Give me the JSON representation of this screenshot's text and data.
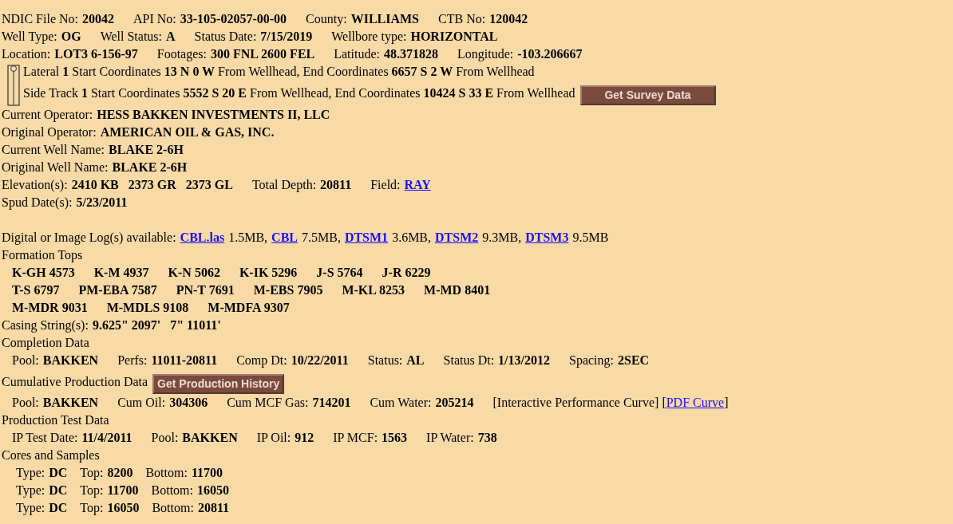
{
  "well_header": [
    [
      {
        "label": "NDIC File No:",
        "value": "20042"
      },
      {
        "label": "API No:",
        "value": "33-105-02057-00-00"
      },
      {
        "label": "County:",
        "value": "WILLIAMS"
      },
      {
        "label": "CTB No:",
        "value": "120042"
      }
    ],
    [
      {
        "label": "Well Type:",
        "value": "OG"
      },
      {
        "label": "Well Status:",
        "value": "A"
      },
      {
        "label": "Status Date:",
        "value": "7/15/2019"
      },
      {
        "label": "Wellbore type:",
        "value": "HORIZONTAL"
      }
    ],
    [
      {
        "label": "Location:",
        "value": "LOT3 6-156-97"
      },
      {
        "label": "Footages:",
        "value": "300 FNL 2600 FEL"
      },
      {
        "label": "Latitude:",
        "value": "48.371828"
      },
      {
        "label": "Longitude:",
        "value": "-103.206667"
      }
    ]
  ],
  "laterals": {
    "lines": [
      "Lateral **1** Start Coordinates **13 N 0 W** From Wellhead, End Coordinates **6657 S 2 W** From Wellhead",
      "Side Track **1** Start Coordinates **5552 S 20 E** From Wellhead, End Coordinates **10424 S 33 E** From Wellhead"
    ],
    "button": "Get Survey Data"
  },
  "operator_fields": [
    {
      "label": "Current Operator:",
      "value": "HESS BAKKEN INVESTMENTS II, LLC"
    },
    {
      "label": "Original Operator:",
      "value": "AMERICAN OIL & GAS, INC."
    },
    {
      "label": "Current Well Name:",
      "value": "BLAKE 2-6H"
    },
    {
      "label": "Original Well Name:",
      "value": "BLAKE 2-6H"
    }
  ],
  "elevation_row": {
    "fields": [
      {
        "label": "Elevation(s):",
        "value": "2410 KB   2373 GR   2373 GL"
      },
      {
        "label": "Total Depth:",
        "value": "20811"
      }
    ],
    "field_label": "Field:",
    "field_link": "RAY"
  },
  "spud": {
    "label": "Spud Date(s):",
    "value": "5/23/2011"
  },
  "logs": {
    "label": "Digital or Image Log(s) available:",
    "files": [
      {
        "name": "CBL.las",
        "size": "1.5MB,"
      },
      {
        "name": "CBL",
        "size": "7.5MB,"
      },
      {
        "name": "DTSM1",
        "size": "3.6MB,"
      },
      {
        "name": "DTSM2",
        "size": "9.3MB,"
      },
      {
        "name": "DTSM3",
        "size": "9.5MB"
      }
    ]
  },
  "formation_tops": {
    "title": "Formation Tops",
    "rows": [
      [
        "K-GH 4573",
        "K-M 4937",
        "K-N 5062",
        "K-IK 5296",
        "J-S 5764",
        "J-R 6229"
      ],
      [
        "T-S 6797",
        "PM-EBA 7587",
        "PN-T 7691",
        "M-EBS 7905",
        "M-KL 8253",
        "M-MD 8401"
      ],
      [
        "M-MDR 9031",
        "M-MDLS 9108",
        "M-MDFA 9307"
      ]
    ]
  },
  "casing": {
    "label": "Casing String(s):",
    "value": "9.625\" 2097'   7\" 11011'"
  },
  "completion": {
    "title": "Completion Data",
    "fields": [
      {
        "label": "Pool:",
        "value": "BAKKEN"
      },
      {
        "label": "Perfs:",
        "value": "11011-20811"
      },
      {
        "label": "Comp Dt:",
        "value": "10/22/2011"
      },
      {
        "label": "Status:",
        "value": "AL"
      },
      {
        "label": "Status Dt:",
        "value": "1/13/2012"
      },
      {
        "label": "Spacing:",
        "value": "2SEC"
      }
    ]
  },
  "cumulative_production": {
    "title": "Cumulative Production Data",
    "button": "Get Production History",
    "fields": [
      {
        "label": "Pool:",
        "value": "BAKKEN"
      },
      {
        "label": "Cum Oil:",
        "value": "304306"
      },
      {
        "label": "Cum MCF Gas:",
        "value": "714201"
      },
      {
        "label": "Cum Water:",
        "value": "205214"
      }
    ],
    "curve_text": "[Interactive Performance Curve] [",
    "pdf_link": "PDF Curve",
    "curve_close": "]"
  },
  "production_test": {
    "title": "Production Test Data",
    "fields": [
      {
        "label": "IP Test Date:",
        "value": "11/4/2011"
      },
      {
        "label": "Pool:",
        "value": "BAKKEN"
      },
      {
        "label": "IP Oil:",
        "value": "912"
      },
      {
        "label": "IP MCF:",
        "value": "1563"
      },
      {
        "label": "IP Water:",
        "value": "738"
      }
    ]
  },
  "cores": {
    "title": "Cores and Samples",
    "rows": [
      [
        {
          "label": "Type:",
          "value": "DC"
        },
        {
          "label": "Top:",
          "value": "8200"
        },
        {
          "label": "Bottom:",
          "value": "11700"
        }
      ],
      [
        {
          "label": "Type:",
          "value": "DC"
        },
        {
          "label": "Top:",
          "value": "11700"
        },
        {
          "label": "Bottom:",
          "value": "16050"
        }
      ],
      [
        {
          "label": "Type:",
          "value": "DC"
        },
        {
          "label": "Top:",
          "value": "16050"
        },
        {
          "label": "Bottom:",
          "value": "20811"
        }
      ]
    ]
  }
}
